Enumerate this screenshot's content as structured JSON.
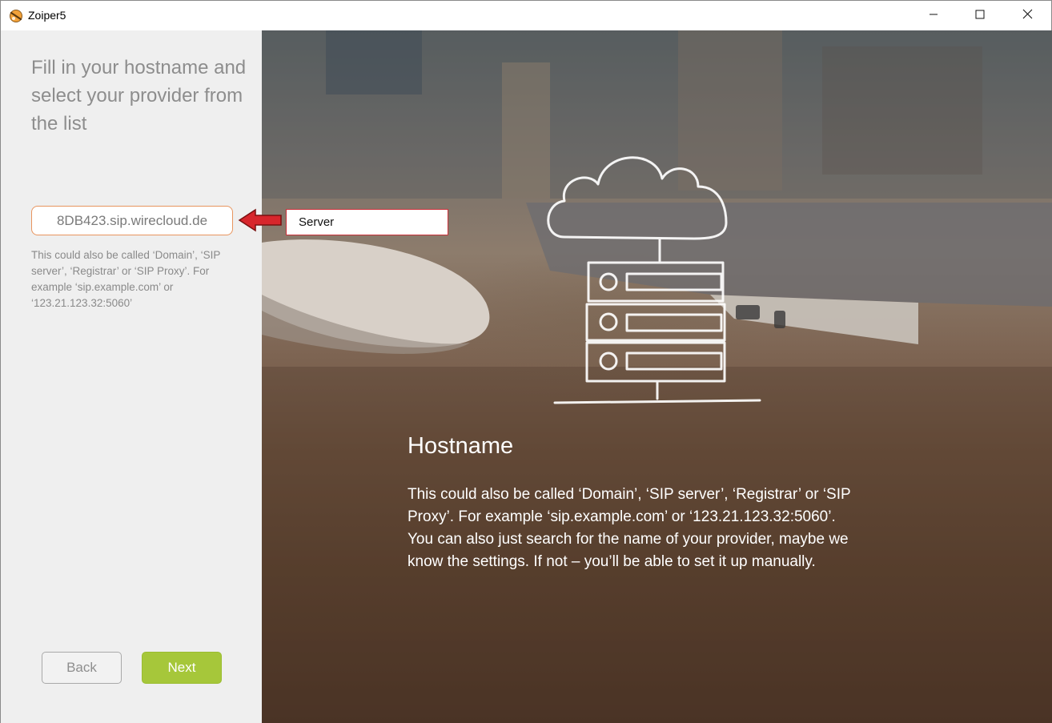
{
  "window": {
    "title": "Zoiper5",
    "controls": {
      "minimize": "minimize-icon",
      "maximize": "maximize-icon",
      "close": "close-icon"
    }
  },
  "left_panel": {
    "heading": "Fill in your hostname and select your provider from the list",
    "hostname_input": {
      "value": "8DB423.sip.wirecloud.de"
    },
    "hint": "This could also be called ‘Domain’, ‘SIP server’, ‘Registrar’ or ‘SIP Proxy’. For example ‘sip.example.com’ or ‘123.21.123.32:5060’",
    "back_label": "Back",
    "next_label": "Next"
  },
  "annotation": {
    "label": "Server",
    "arrow_color": "#d7262c"
  },
  "info_panel": {
    "illustration": "cloud-server-icon",
    "title": "Hostname",
    "description": "This could also be called ‘Domain’, ‘SIP server’, ‘Registrar’ or ‘SIP Proxy’. For example ‘sip.example.com’ or ‘123.21.123.32:5060’. You can also just search for the name of your provider, maybe we know the settings. If not – you’ll be able to set it up manually."
  },
  "colors": {
    "input_border": "#e8955f",
    "next_button": "#a6c73a",
    "heading_text": "#8d8d8d"
  }
}
